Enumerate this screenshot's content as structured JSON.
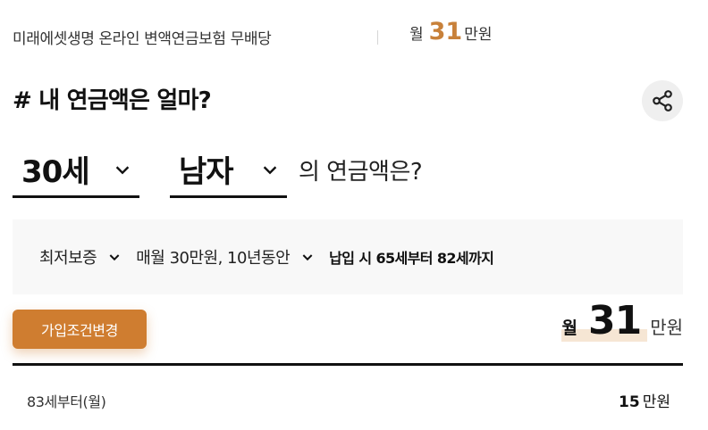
{
  "header": {
    "product_name": "미래에셋생명 온라인 변액연금보험 무배당",
    "amount_prefix": "월",
    "amount_value": "31",
    "amount_unit": "만원"
  },
  "question": {
    "title": "# 내 연금액은 얼마?",
    "share_icon": "share-icon"
  },
  "selectors": {
    "age": "30세",
    "gender": "남자",
    "suffix": "의 연금액은?"
  },
  "filters": {
    "guarantee": "최저보증",
    "payment": "매월 30만원, 10년동안",
    "pay_info": "납입 시 65세부터 82세까지"
  },
  "result": {
    "button_label": "가입조건변경",
    "amount_prefix": "월",
    "amount_value": "31",
    "amount_unit": "만원"
  },
  "breakdown": [
    {
      "label": "83세부터(월)",
      "value": "15",
      "unit": "만원"
    }
  ],
  "colors": {
    "accent": "#c8813a",
    "button": "#cf7d30",
    "highlight": "#f6e6d4"
  }
}
